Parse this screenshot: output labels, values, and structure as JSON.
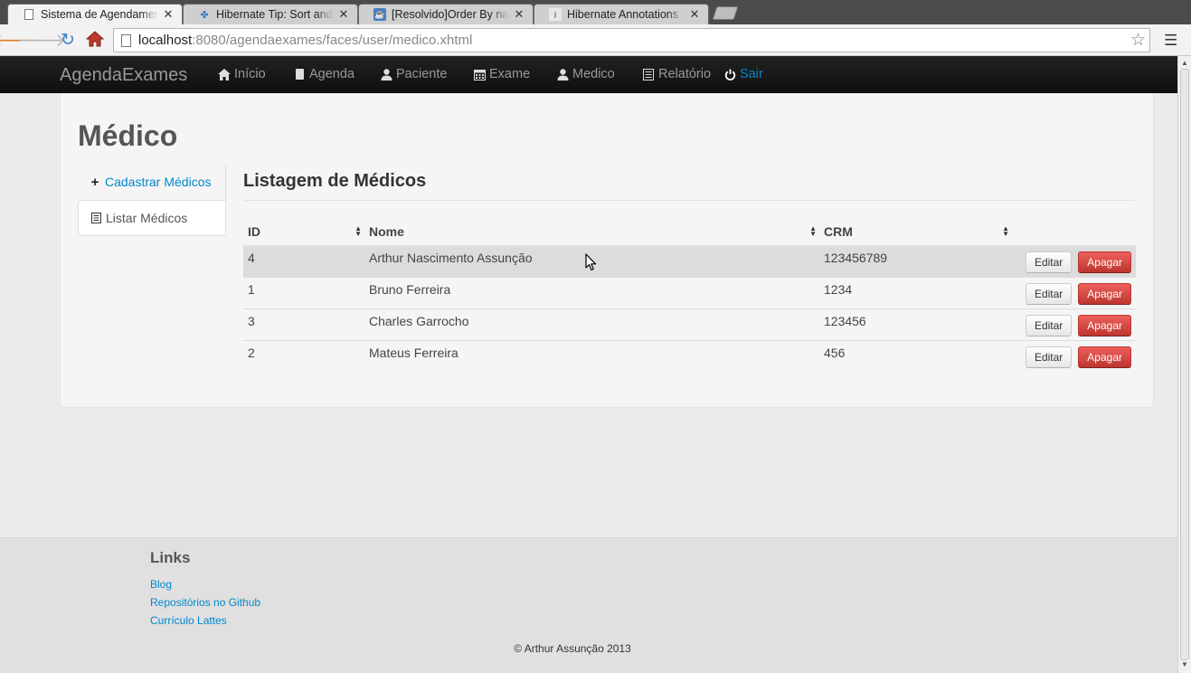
{
  "browser": {
    "tabs": [
      {
        "title": "Sistema de Agendamento",
        "active": true
      },
      {
        "title": "Hibernate Tip: Sort and O",
        "active": false
      },
      {
        "title": "[Resolvido]Order By na an",
        "active": false
      },
      {
        "title": "Hibernate Annotations",
        "active": false
      }
    ],
    "url_host": "localhost",
    "url_rest": ":8080/agendaexames/faces/user/medico.xhtml"
  },
  "navbar": {
    "brand": "AgendaExames",
    "items": [
      {
        "label": "Início",
        "icon": "home-icon"
      },
      {
        "label": "Agenda",
        "icon": "book-icon"
      },
      {
        "label": "Paciente",
        "icon": "user-icon"
      },
      {
        "label": "Exame",
        "icon": "calendar-icon"
      },
      {
        "label": "Medico",
        "icon": "user-icon"
      },
      {
        "label": "Relatório",
        "icon": "list-icon"
      },
      {
        "label": "Sair",
        "icon": "power-icon"
      }
    ]
  },
  "page": {
    "title": "Médico",
    "side_menu": [
      {
        "label": "Cadastrar Médicos",
        "icon": "plus-icon",
        "active": false
      },
      {
        "label": "Listar Médicos",
        "icon": "list-icon",
        "active": true
      }
    ],
    "section_title": "Listagem de Médicos",
    "table": {
      "headers": [
        "ID",
        "Nome",
        "CRM"
      ],
      "rows": [
        {
          "id": "4",
          "nome": "Arthur Nascimento Assunção",
          "crm": "123456789"
        },
        {
          "id": "1",
          "nome": "Bruno Ferreira",
          "crm": "1234"
        },
        {
          "id": "3",
          "nome": "Charles Garrocho",
          "crm": "123456"
        },
        {
          "id": "2",
          "nome": "Mateus Ferreira",
          "crm": "456"
        }
      ],
      "edit_label": "Editar",
      "delete_label": "Apagar"
    }
  },
  "footer": {
    "heading": "Links",
    "links": [
      "Blog",
      "Repositórios no Github",
      "Currículo Lattes"
    ],
    "copyright": "© Arthur Assunção 2013"
  },
  "colors": {
    "link": "#0088cc",
    "navbar_bg": "#1b1b1b",
    "delete_button": "#da4f49"
  }
}
